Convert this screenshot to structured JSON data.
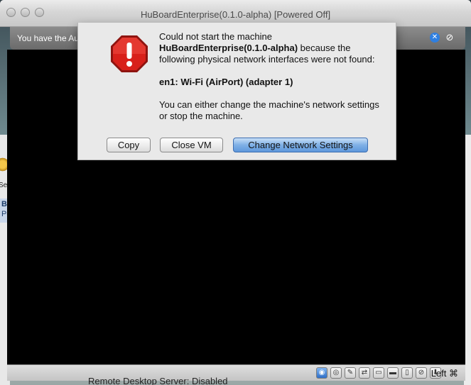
{
  "window": {
    "title": "HuBoardEnterprise(0.1.0-alpha) [Powered Off]"
  },
  "infobar": {
    "message": "You have the Auto capture keyboard option turned on. This will cause the Virtual Machine to"
  },
  "dialog": {
    "line1": "Could not start the machine",
    "machine_name": "HuBoardEnterprise(0.1.0-alpha)",
    "line2_rest": " because the following physical network interfaces were not found:",
    "interface": "en1: Wi-Fi (AirPort) (adapter 1)",
    "line3": "You can either change the machine's network settings or stop the machine.",
    "buttons": {
      "copy": "Copy",
      "close_vm": "Close VM",
      "change_settings": "Change Network Settings"
    }
  },
  "statusbar": {
    "host_key": "Left ⌘",
    "icons": [
      "hard-disk-icon",
      "optical-disk-icon",
      "usb-icon",
      "network-icon",
      "shared-folder-icon",
      "display-icon",
      "video-capture-icon",
      "mouse-integration-icon",
      "keyboard-capture-icon"
    ]
  },
  "background": {
    "left_label": "Set",
    "left_selected_1": "Bo",
    "left_selected_2": "Po",
    "bottom_text": "Remote Desktop Server:   Disabled"
  },
  "colors": {
    "accent": "#5f98dc",
    "stop_red": "#d8201a"
  }
}
